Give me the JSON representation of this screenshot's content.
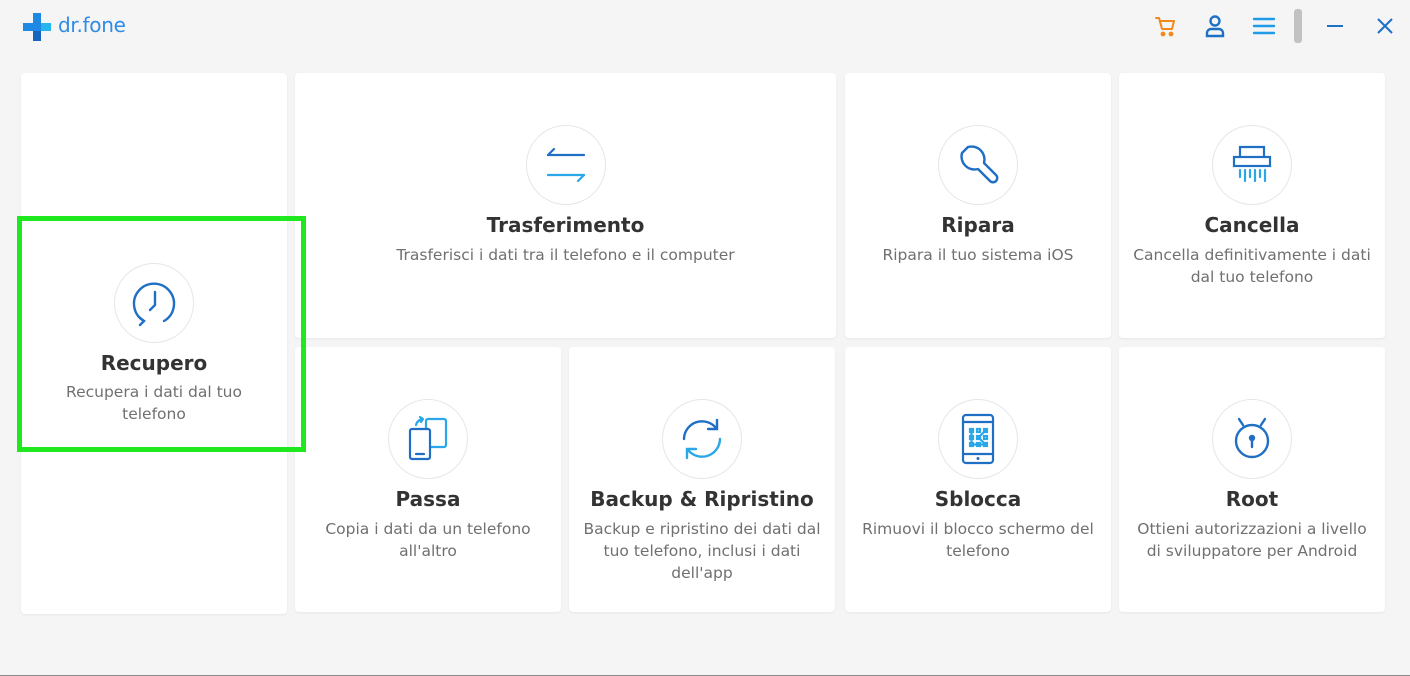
{
  "app": {
    "name": "dr.fone"
  },
  "titlebar": {
    "icons": [
      "cart-icon",
      "user-icon",
      "menu-icon",
      "minimize-icon",
      "close-icon"
    ],
    "colors": {
      "cart": "#f08a1c",
      "blue": "#1f6fc5",
      "accent": "#2f8be5"
    }
  },
  "tools": {
    "recupero": {
      "title": "Recupero",
      "desc": "Recupera i dati dal tuo telefono"
    },
    "trasferimento": {
      "title": "Trasferimento",
      "desc": "Trasferisci i dati tra il telefono e il computer"
    },
    "ripara": {
      "title": "Ripara",
      "desc": "Ripara il tuo sistema iOS"
    },
    "cancella": {
      "title": "Cancella",
      "desc": "Cancella definitivamente i dati dal tuo telefono"
    },
    "passa": {
      "title": "Passa",
      "desc": "Copia i dati da un telefono all'altro"
    },
    "backup": {
      "title": "Backup & Ripristino",
      "desc": "Backup e ripristino dei dati dal tuo telefono, inclusi i dati dell'app"
    },
    "sblocca": {
      "title": "Sblocca",
      "desc": "Rimuovi il blocco schermo del telefono"
    },
    "root": {
      "title": "Root",
      "desc": "Ottieni autorizzazioni a livello di sviluppatore per Android"
    }
  },
  "highlight": {
    "color": "#1fe81f",
    "target": "Recupero"
  }
}
